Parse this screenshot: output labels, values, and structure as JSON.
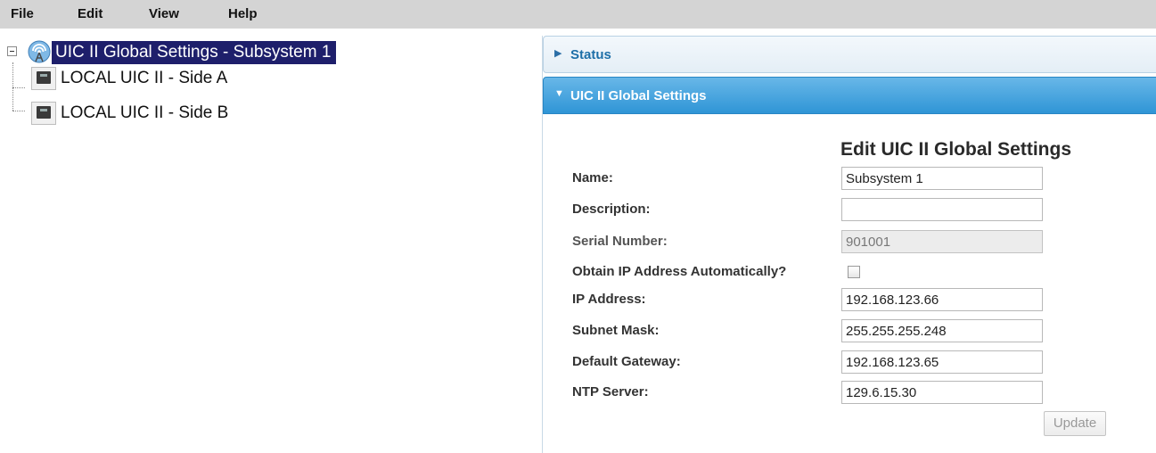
{
  "menu": {
    "items": [
      {
        "label": "File"
      },
      {
        "label": "Edit"
      },
      {
        "label": "View"
      },
      {
        "label": "Help"
      }
    ]
  },
  "tree": {
    "root": {
      "label": "UIC II Global Settings - Subsystem 1",
      "icon": "antenna-icon",
      "selected": true
    },
    "children": [
      {
        "label": "LOCAL UIC II - Side A",
        "icon": "device-icon"
      },
      {
        "label": "LOCAL UIC II - Side B",
        "icon": "device-icon"
      }
    ]
  },
  "panel": {
    "status_section": {
      "title": "Status",
      "expanded": false
    },
    "global_section": {
      "title": "UIC II Global Settings",
      "expanded": true
    },
    "form": {
      "title": "Edit UIC II Global Settings",
      "fields": {
        "name": {
          "label": "Name:",
          "value": "Subsystem 1"
        },
        "description": {
          "label": "Description:",
          "value": ""
        },
        "serial_number": {
          "label": "Serial Number:",
          "value": "901001",
          "disabled": true
        },
        "obtain_ip": {
          "label": "Obtain IP Address Automatically?",
          "checked": false
        },
        "ip_address": {
          "label": "IP Address:",
          "value": "192.168.123.66"
        },
        "subnet_mask": {
          "label": "Subnet Mask:",
          "value": "255.255.255.248"
        },
        "default_gateway": {
          "label": "Default Gateway:",
          "value": "192.168.123.65"
        },
        "ntp_server": {
          "label": "NTP Server:",
          "value": "129.6.15.30"
        }
      },
      "update_label": "Update"
    }
  },
  "colors": {
    "selection": "#1e1f6b",
    "accordion_active": "#2f95d6",
    "accordion_title": "#1d6fa8",
    "menubar": "#d4d4d4"
  }
}
